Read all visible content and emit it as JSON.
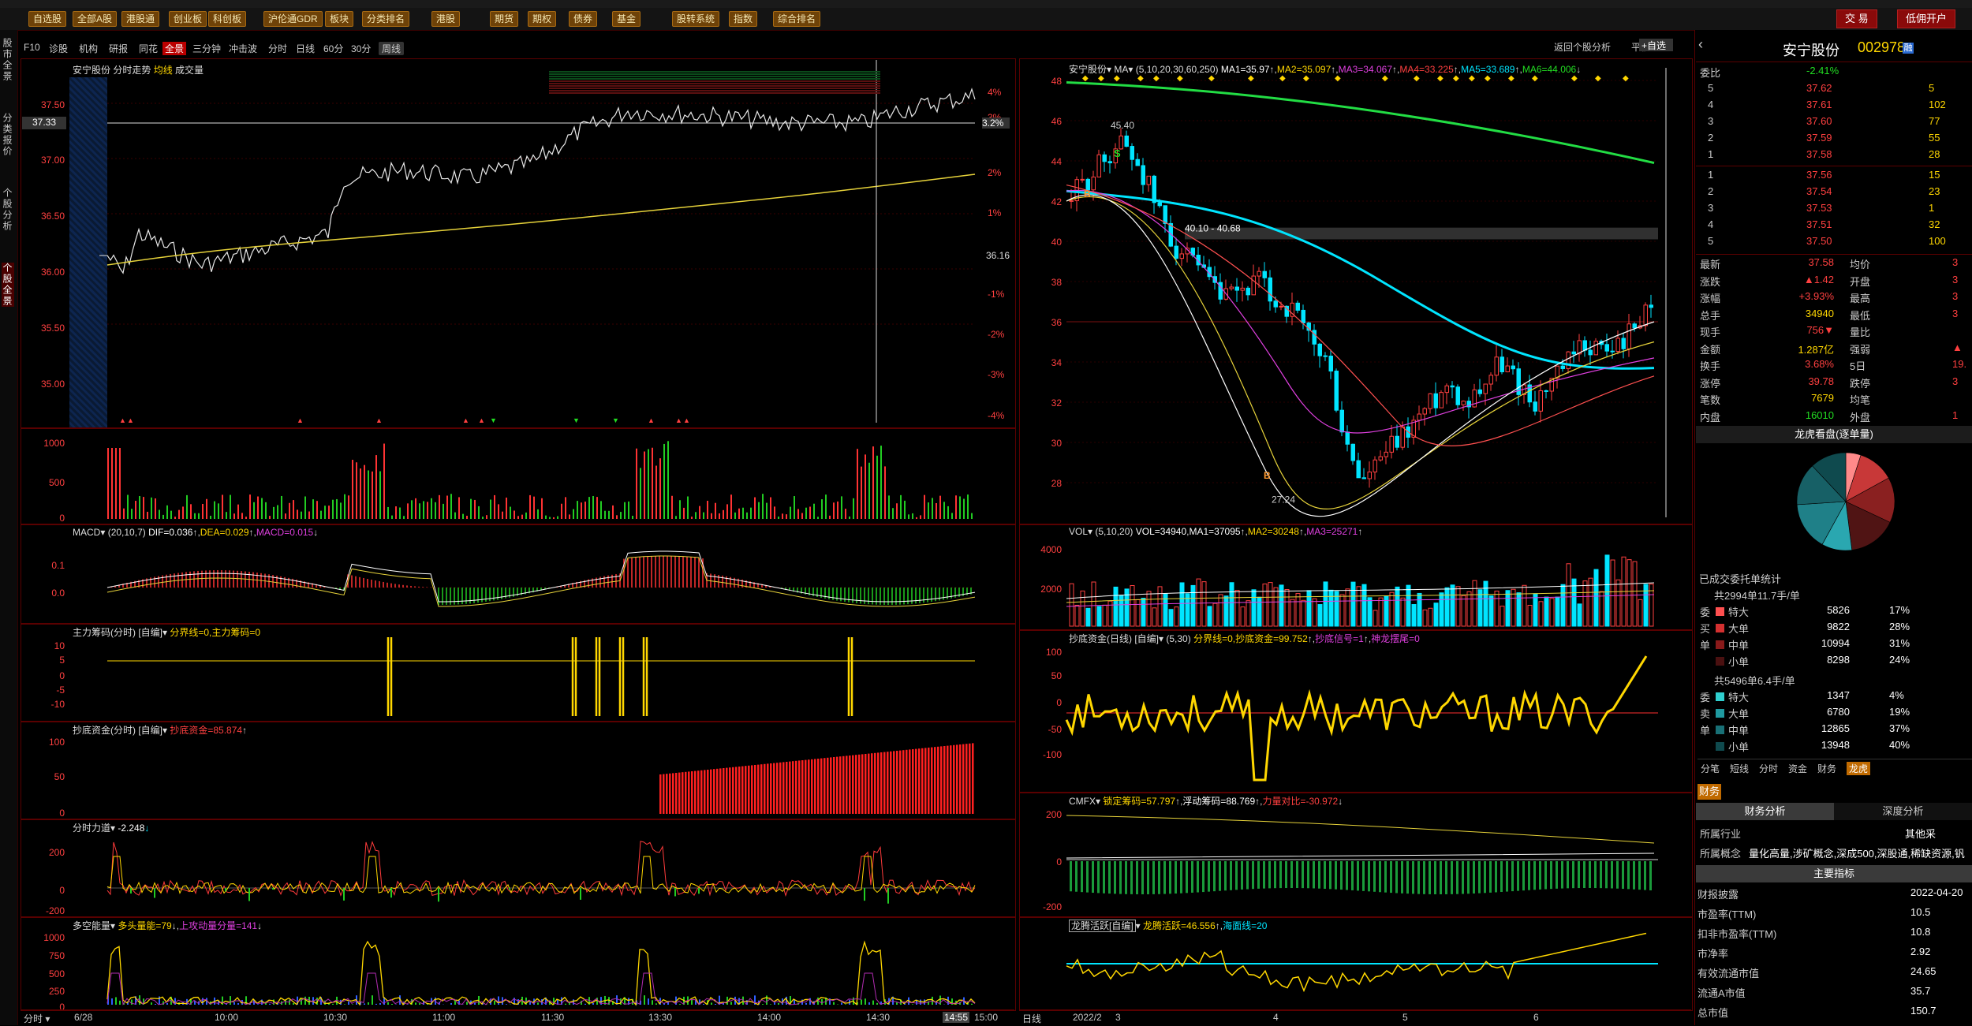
{
  "toolbar": {
    "buttons": [
      "自选股",
      "全部A股",
      "港股通",
      "创业板",
      "科创板",
      "沪伦通GDR",
      "板块",
      "分类排名",
      "港股",
      "期货",
      "期权",
      "债券",
      "基金",
      "股转系统",
      "指数",
      "综合排名"
    ],
    "trade": "交 易",
    "margin": "低佣开户"
  },
  "leftTabs": [
    "股市全景",
    "分类报价",
    "个股分析",
    "个股全景"
  ],
  "subbar": {
    "items": [
      "F10",
      "诊股",
      "机构",
      "研报",
      "同花",
      "分时",
      "日线",
      "60分",
      "30分",
      "周线"
    ],
    "fenshi": [
      "分时",
      "日线",
      "60分",
      "30分",
      "周线"
    ],
    "quick": [
      "全景",
      "三分钟",
      "冲击波"
    ],
    "back": "返回个股分析",
    "flat": "平移",
    "selfsel": "+自选"
  },
  "intraday": {
    "title": "安宁股份 分时走势",
    "avg": "均线",
    "vol": "成交量",
    "priceLabels": [
      "37.50",
      "37.00",
      "36.50",
      "36.00",
      "35.50",
      "35.00"
    ],
    "pctLabels": [
      "4%",
      "3.2%",
      "3%",
      "2%",
      "1%",
      "-1%",
      "-2%",
      "-3%",
      "-4%"
    ],
    "refPrice": "37.33",
    "base": "36.16",
    "timeLabels": [
      "6/28",
      "10:00",
      "10:30",
      "11:00",
      "11:30",
      "13:30",
      "14:00",
      "14:30",
      "14:55",
      "15:00"
    ],
    "volLabels": [
      "1000",
      "500",
      "0"
    ],
    "macd": {
      "name": "MACD",
      "params": "(20,10,7)",
      "dif": "DIF=0.036",
      "dea": "DEA=0.029",
      "macd": "MACD=0.015",
      "labels": [
        "0.1",
        "0.0"
      ]
    },
    "zl": {
      "name": "主力筹码(分时) [自编]",
      "a": "分界线=0,主力筹码=0",
      "labels": [
        "10",
        "5",
        "0",
        "-5",
        "-10"
      ]
    },
    "cd": {
      "name": "抄底资金(分时) [自编]",
      "a": "抄底资金=85.874",
      "labels": [
        "100",
        "50",
        "0"
      ]
    },
    "fs": {
      "name": "分时力道",
      "a": "-2.248",
      "labels": [
        "200",
        "0",
        "-200"
      ]
    },
    "dk": {
      "name": "多空能量",
      "a": "多头量能=79",
      "b": "上攻动量分量=141",
      "labels": [
        "1000",
        "750",
        "500",
        "250",
        "0"
      ]
    }
  },
  "daily": {
    "stock": "安宁股份",
    "ma": {
      "params": "(5,10,20,30,60,250)",
      "ma1": "MA1=35.97",
      "ma2": "MA2=35.097",
      "ma3": "MA3=34.067",
      "ma4": "MA4=33.225",
      "ma5": "MA5=33.689",
      "ma6": "MA6=44.006"
    },
    "priceLabels": [
      "48",
      "46",
      "44",
      "42",
      "40",
      "38",
      "36",
      "34",
      "32",
      "30",
      "28"
    ],
    "high": "45.40",
    "low": "27.24",
    "band": "40.10 - 40.68",
    "vol": {
      "name": "VOL",
      "params": "(5,10,20)",
      "v": "VOL=34940",
      "ma1": "MA1=37095",
      "ma2": "MA2=30248",
      "ma3": "MA3=25271",
      "labels": [
        "4000",
        "2000"
      ]
    },
    "cd": {
      "name": "抄底资金(日线) [自编]",
      "params": "(5,30)",
      "a": "分界线=0,抄底资金=99.752",
      "b": "抄底信号=1",
      "c": "神龙摆尾=0",
      "labels": [
        "100",
        "50",
        "0",
        "-50",
        "-100"
      ]
    },
    "cmfx": {
      "name": "CMFX",
      "a": "锁定筹码=57.797",
      "b": "浮动筹码=88.769",
      "c": "力量对比=-30.972",
      "labels": [
        "200",
        "0",
        "-200"
      ]
    },
    "lt": {
      "name": "龙腾活跃[自编]",
      "a": "龙腾活跃=46.556",
      "b": "海面线=20"
    },
    "timeLabels": [
      "日线",
      "2022/2",
      "3",
      "4",
      "5",
      "6"
    ]
  },
  "quote": {
    "name": "安宁股份",
    "code": "002978",
    "webi": "委比",
    "webiVal": "-2.41%",
    "sells": [
      [
        "5",
        "37.62",
        "5"
      ],
      [
        "4",
        "37.61",
        "102"
      ],
      [
        "3",
        "37.60",
        "77"
      ],
      [
        "2",
        "37.59",
        "55"
      ],
      [
        "1",
        "37.58",
        "28"
      ]
    ],
    "buys": [
      [
        "1",
        "37.56",
        "15"
      ],
      [
        "2",
        "37.54",
        "23"
      ],
      [
        "3",
        "37.53",
        "1"
      ],
      [
        "4",
        "37.51",
        "32"
      ],
      [
        "5",
        "37.50",
        "100"
      ]
    ],
    "stats": [
      [
        "最新",
        "37.58",
        "均价",
        "3"
      ],
      [
        "涨跌",
        "▲1.42",
        "开盘",
        "3"
      ],
      [
        "涨幅",
        "+3.93%",
        "最高",
        "3"
      ],
      [
        "总手",
        "34940",
        "最低",
        "3"
      ],
      [
        "现手",
        "756▼",
        "量比",
        ""
      ],
      [
        "金额",
        "1.287亿",
        "强弱",
        "▲"
      ],
      [
        "换手",
        "3.68%",
        "5日",
        "19."
      ],
      [
        "涨停",
        "39.78",
        "跌停",
        "3"
      ],
      [
        "笔数",
        "7679",
        "均笔",
        ""
      ],
      [
        "内盘",
        "16010",
        "外盘",
        "1"
      ]
    ],
    "dragon": "龙虎看盘(逐单量)",
    "orderTitle": "已成交委托单统计",
    "buyTotal": "共2994单11.7手/单",
    "buyRows": [
      [
        "特大",
        "5826",
        "17%"
      ],
      [
        "大单",
        "9822",
        "28%"
      ],
      [
        "中单",
        "10994",
        "31%"
      ],
      [
        "小单",
        "8298",
        "24%"
      ]
    ],
    "sellTotal": "共5496单6.4手/单",
    "sellRows": [
      [
        "特大",
        "1347",
        "4%"
      ],
      [
        "大单",
        "6780",
        "19%"
      ],
      [
        "中单",
        "12865",
        "37%"
      ],
      [
        "小单",
        "13948",
        "40%"
      ]
    ],
    "tabs": [
      "分笔",
      "短线",
      "分时",
      "资金",
      "财务",
      "龙虎"
    ],
    "fin": "财务",
    "finTabs": [
      "财务分析",
      "深度分析"
    ],
    "industry": [
      "所属行业",
      "其他采"
    ],
    "concept": [
      "所属概念",
      "量化高量,涉矿概念,深成500,深股通,稀缺资源,钒"
    ],
    "main": "主要指标",
    "metrics": [
      [
        "财报披露",
        "2022-04-20"
      ],
      [
        "市盈率(TTM)",
        "10.5"
      ],
      [
        "扣非市盈率(TTM)",
        "10.8"
      ],
      [
        "市净率",
        "2.92"
      ],
      [
        "有效流通市值",
        "24.65"
      ],
      [
        "流通A市值",
        "35.7"
      ],
      [
        "总市值",
        "150.7"
      ]
    ]
  }
}
